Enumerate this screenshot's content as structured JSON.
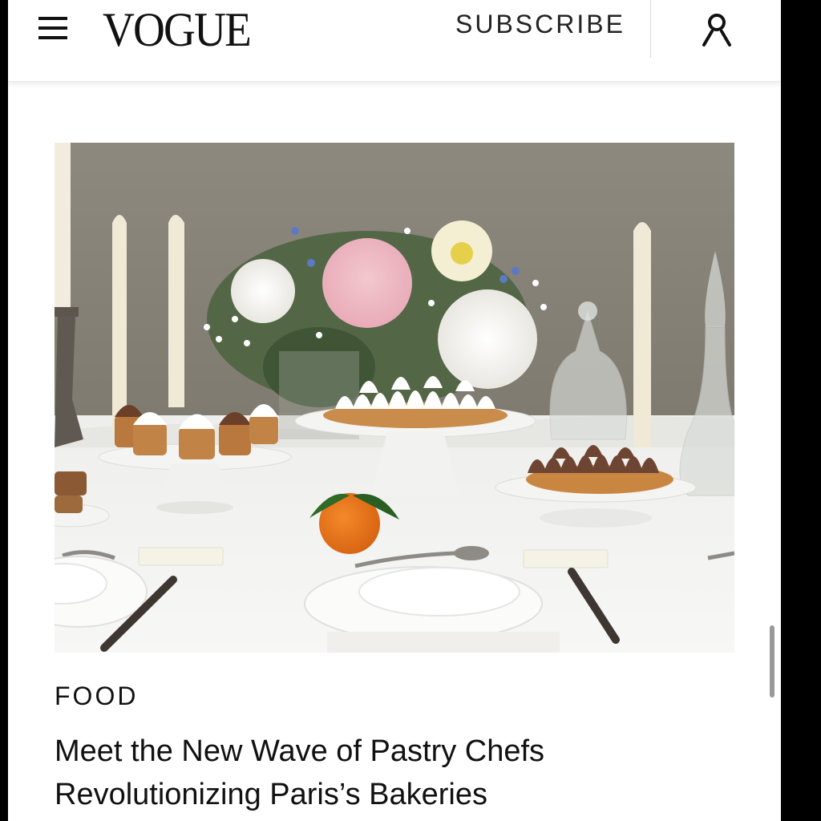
{
  "header": {
    "logo": "VOGUE",
    "subscribe_label": "SUBSCRIBE"
  },
  "article": {
    "kicker": "FOOD",
    "headline": "Meet the New Wave of Pastry Chefs Revolutionizing Paris’s Bakeries"
  },
  "colors": {
    "text": "#111111",
    "background": "#ffffff"
  },
  "icons": {
    "menu": "hamburger-menu-icon",
    "account": "user-account-icon"
  }
}
